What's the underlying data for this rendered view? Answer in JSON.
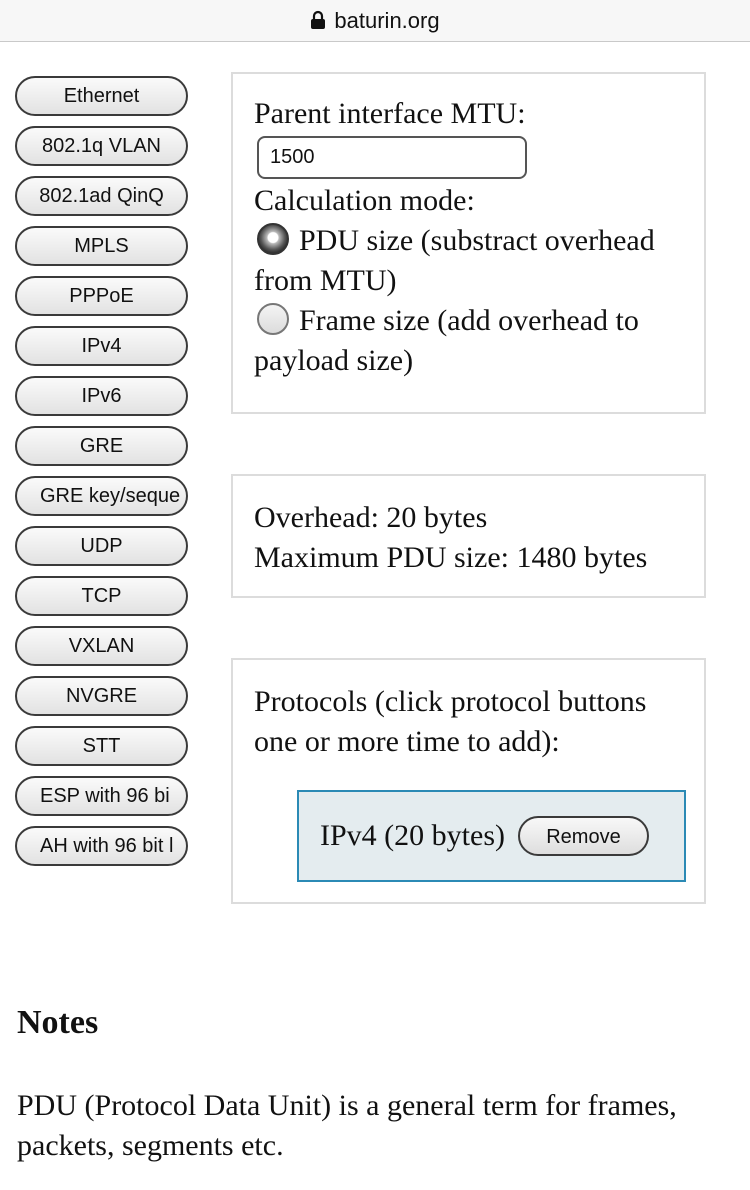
{
  "address_bar": {
    "url": "baturin.org",
    "icon": "lock-icon"
  },
  "protocol_buttons": [
    "Ethernet",
    "802.1q VLAN",
    "802.1ad QinQ",
    "MPLS",
    "PPPoE",
    "IPv4",
    "IPv6",
    "GRE",
    "GRE key/seque",
    "UDP",
    "TCP",
    "VXLAN",
    "NVGRE",
    "STT",
    "ESP with 96 bi",
    "AH with 96 bit l"
  ],
  "settings": {
    "mtu_label": "Parent interface MTU:",
    "mtu_value": "1500",
    "mode_label": "Calculation mode:",
    "modes": [
      {
        "label": "PDU size (substract overhead from MTU)",
        "checked": true
      },
      {
        "label": "Frame size (add overhead to payload size)",
        "checked": false
      }
    ]
  },
  "result": {
    "overhead": "Overhead: 20 bytes",
    "max_pdu": "Maximum PDU size: 1480 bytes"
  },
  "protocols": {
    "heading": "Protocols (click protocol buttons one or more time to add):",
    "added": [
      {
        "label": "IPv4 (20 bytes)",
        "remove_label": "Remove"
      }
    ],
    "accent_color": "#2b8ab5"
  },
  "notes": {
    "title": "Notes",
    "text": "PDU (Protocol Data Unit) is a general term for frames, packets, segments etc."
  }
}
